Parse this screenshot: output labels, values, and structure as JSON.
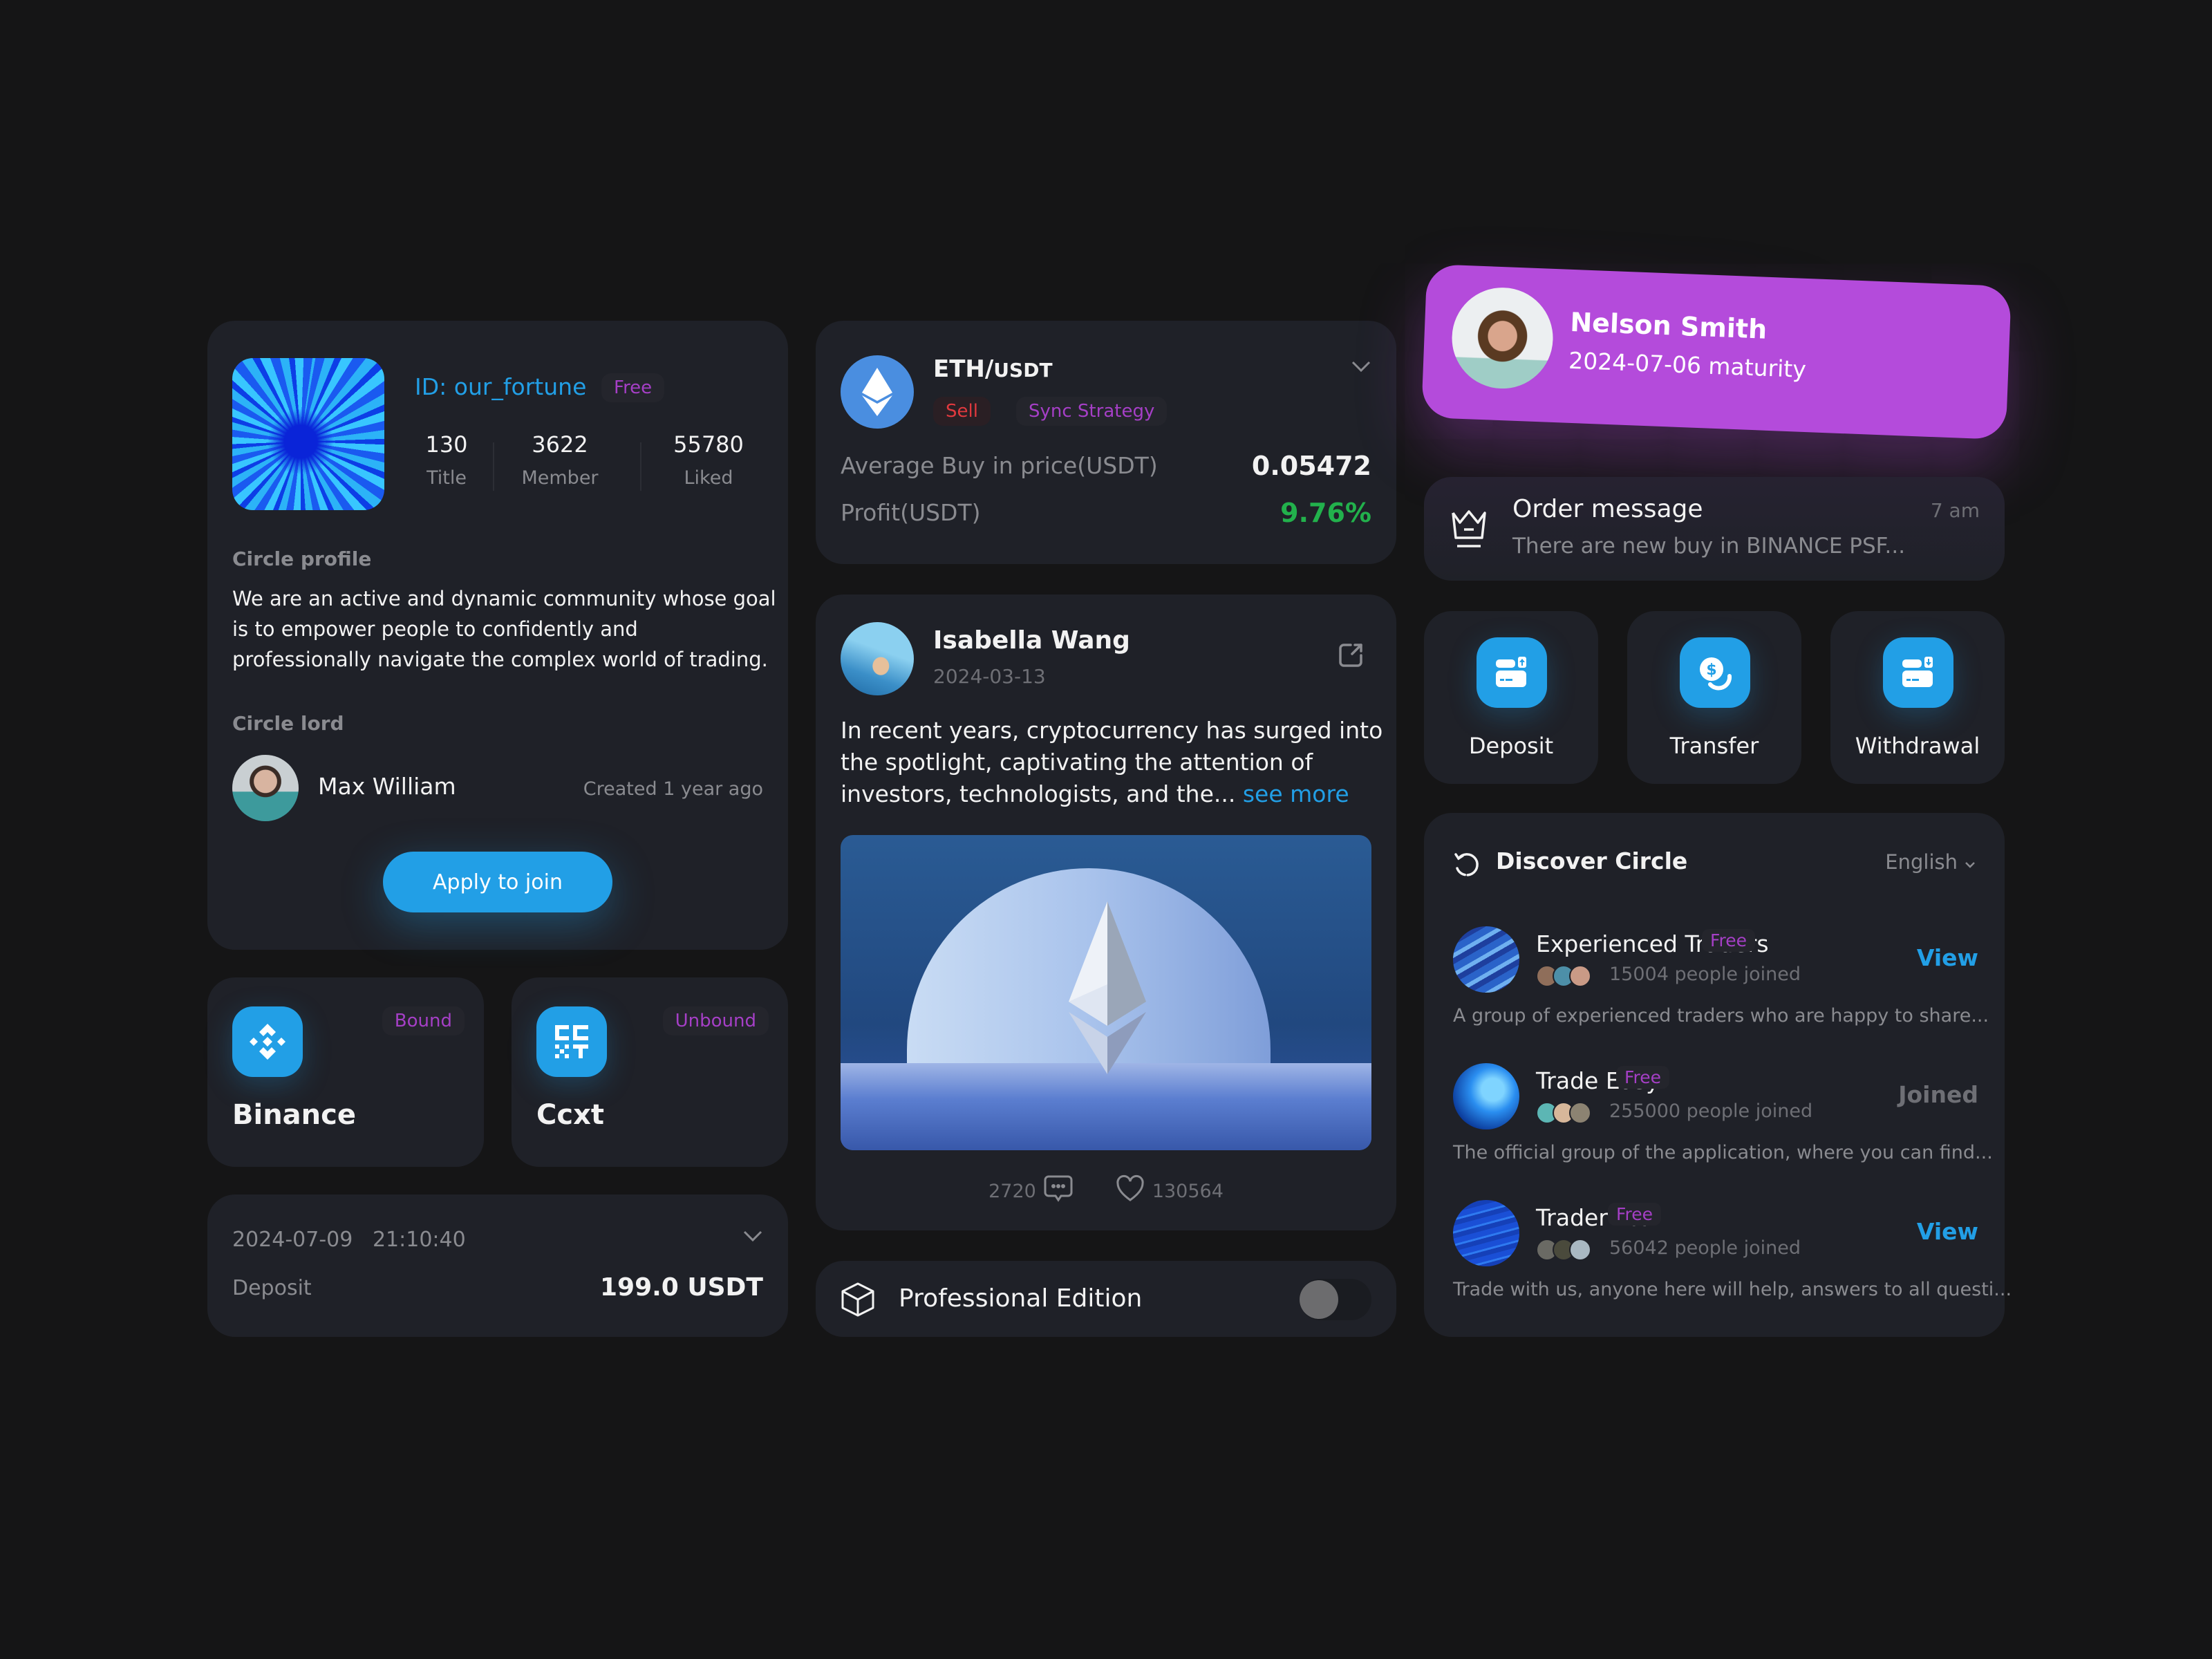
{
  "circle": {
    "id": "ID: our_fortune",
    "tier": "Free",
    "stats": [
      {
        "value": "130",
        "label": "Title"
      },
      {
        "value": "3622",
        "label": "Member"
      },
      {
        "value": "55780",
        "label": "Liked"
      }
    ],
    "profile_label": "Circle profile",
    "profile_text": "We are an active and dynamic community whose goal is to empower people to confidently and professionally navigate the complex world of trading.",
    "lord_label": "Circle lord",
    "lord_name": "Max William",
    "created": "Created 1 year ago",
    "apply_label": "Apply to join"
  },
  "exchanges": [
    {
      "name": "Binance",
      "status": "Bound",
      "icon": "binance-icon"
    },
    {
      "name": "Ccxt",
      "status": "Unbound",
      "icon": "ccxt-icon"
    }
  ],
  "deposit_record": {
    "datetime": "2024-07-09   21:10:40",
    "type": "Deposit",
    "amount": "199.0 USDT"
  },
  "trade": {
    "base": "ETH/",
    "quote": "USDT",
    "side": "Sell",
    "strategy": "Sync Strategy",
    "avg_label": "Average Buy in price(USDT)",
    "avg_value": "0.05472",
    "profit_label": "Profit(USDT)",
    "profit_value": "9.76%"
  },
  "post": {
    "author": "Isabella Wang",
    "date": "2024-03-13",
    "text": "In recent years, cryptocurrency has surged into the spotlight, captivating the attention of investors, technologists, and the... ",
    "see_more": "see more",
    "comments": "2720",
    "likes": "130564"
  },
  "pro_edition": {
    "label": "Professional Edition",
    "enabled": false
  },
  "membership": {
    "name": "Nelson Smith",
    "maturity": "2024-07-06 maturity"
  },
  "order_message": {
    "title": "Order message",
    "time": "7 am",
    "text": "There are new buy in BINANCE PSF..."
  },
  "actions": [
    {
      "label": "Deposit",
      "icon": "deposit-icon"
    },
    {
      "label": "Transfer",
      "icon": "transfer-icon"
    },
    {
      "label": "Withdrawal",
      "icon": "withdrawal-icon"
    }
  ],
  "discover": {
    "title": "Discover Circle",
    "language": "English",
    "items": [
      {
        "name": "Experienced Traders",
        "tier": "Free",
        "joined": "15004 people joined",
        "desc": "A group of experienced traders who are happy to share...",
        "action": "View"
      },
      {
        "name": "Trade Easy",
        "tier": "Free",
        "joined": "255000 people joined",
        "desc": "The official group of the application, where you can find...",
        "action": "Joined"
      },
      {
        "name": "Trader BR",
        "tier": "Free",
        "joined": "56042 people joined",
        "desc": "Trade with us, anyone here will help, answers to all questi...",
        "action": "View"
      }
    ]
  },
  "colors": {
    "accent_blue": "#229fe6",
    "purple": "#a53fc6",
    "member_card": "#b44bdb",
    "profit_green": "#22b14c",
    "sell_red": "#e0393e",
    "card_bg": "#1f2128",
    "page_bg": "#151516"
  }
}
